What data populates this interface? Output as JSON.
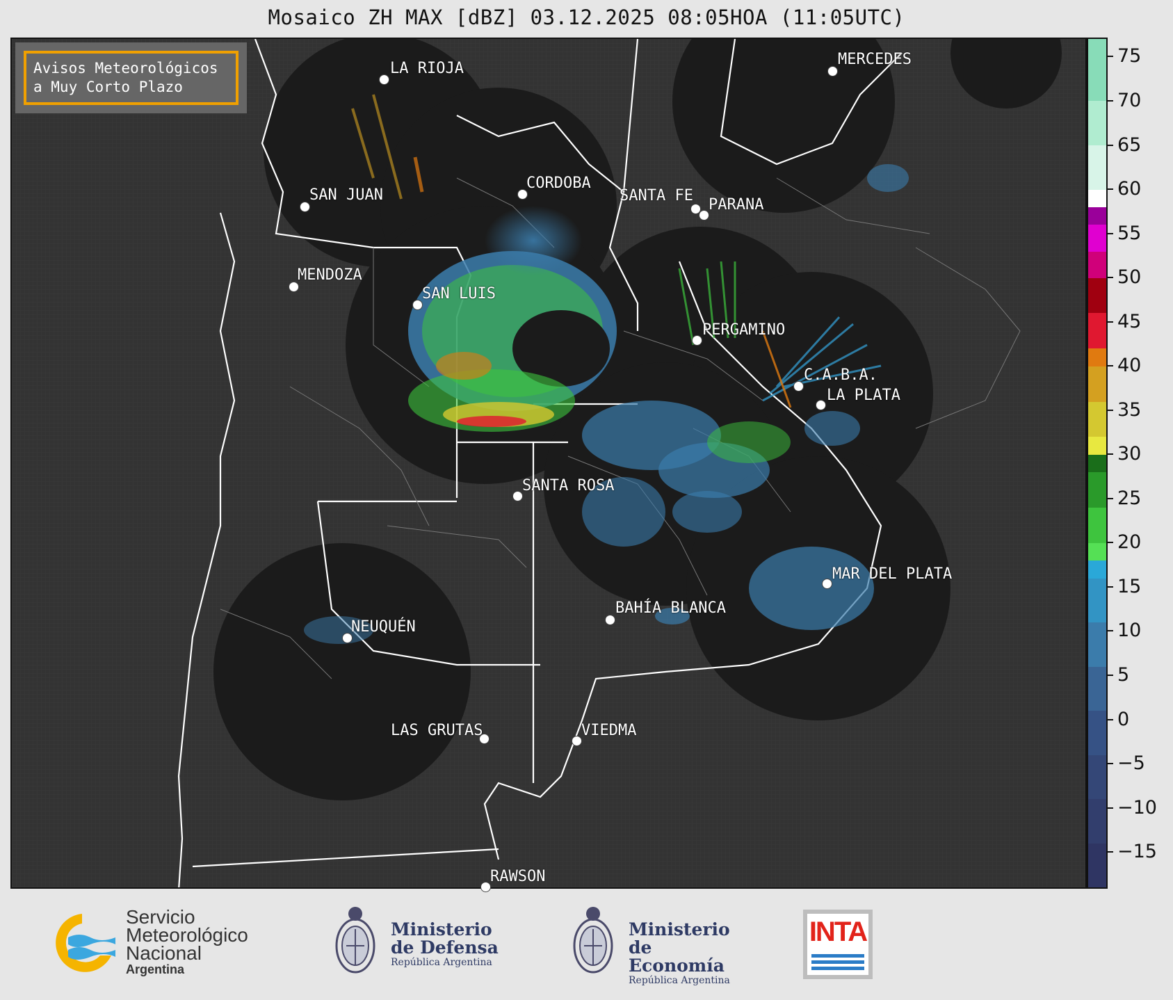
{
  "title": "Mosaico ZH MAX [dBZ] 03.12.2025 08:05HOA (11:05UTC)",
  "notice": {
    "line1": "Avisos Meteorológicos",
    "line2": "a Muy Corto Plazo"
  },
  "colorbar": {
    "unit": "dBZ",
    "range": [
      -19,
      77
    ],
    "ticks": [
      "75",
      "70",
      "65",
      "60",
      "55",
      "50",
      "45",
      "40",
      "35",
      "30",
      "25",
      "20",
      "15",
      "10",
      "5",
      "0",
      "−5",
      "−10",
      "−15"
    ],
    "tick_values": [
      75,
      70,
      65,
      60,
      55,
      50,
      45,
      40,
      35,
      30,
      25,
      20,
      15,
      10,
      5,
      0,
      -5,
      -10,
      -15
    ],
    "bands": [
      {
        "from": -19,
        "to": -14,
        "color": "#2f3563"
      },
      {
        "from": -14,
        "to": -9,
        "color": "#323e6d"
      },
      {
        "from": -9,
        "to": -4,
        "color": "#344777"
      },
      {
        "from": -4,
        "to": 1,
        "color": "#365285"
      },
      {
        "from": 1,
        "to": 6,
        "color": "#3a6595"
      },
      {
        "from": 6,
        "to": 11,
        "color": "#3b7cab"
      },
      {
        "from": 11,
        "to": 16,
        "color": "#3294c4"
      },
      {
        "from": 16,
        "to": 18,
        "color": "#2aa8d8"
      },
      {
        "from": 18,
        "to": 20,
        "color": "#55e055"
      },
      {
        "from": 20,
        "to": 24,
        "color": "#3ec43e"
      },
      {
        "from": 24,
        "to": 28,
        "color": "#2a9a2a"
      },
      {
        "from": 28,
        "to": 30,
        "color": "#1a6e1a"
      },
      {
        "from": 30,
        "to": 32,
        "color": "#e8e840"
      },
      {
        "from": 32,
        "to": 36,
        "color": "#d4c830"
      },
      {
        "from": 36,
        "to": 40,
        "color": "#d4a020"
      },
      {
        "from": 40,
        "to": 42,
        "color": "#e07a10"
      },
      {
        "from": 42,
        "to": 46,
        "color": "#e01830"
      },
      {
        "from": 46,
        "to": 50,
        "color": "#a00010"
      },
      {
        "from": 50,
        "to": 53,
        "color": "#d0007a"
      },
      {
        "from": 53,
        "to": 56,
        "color": "#e000d0"
      },
      {
        "from": 56,
        "to": 58,
        "color": "#9a009a"
      },
      {
        "from": 58,
        "to": 60,
        "color": "#ffffff"
      },
      {
        "from": 60,
        "to": 65,
        "color": "#d8f4e8"
      },
      {
        "from": 65,
        "to": 70,
        "color": "#b0ecd0"
      },
      {
        "from": 70,
        "to": 77,
        "color": "#88dcb8"
      }
    ]
  },
  "cities": [
    {
      "name": "LA RIOJA",
      "dot_id": "la-rioja"
    },
    {
      "name": "MERCEDES",
      "dot_id": "mercedes"
    },
    {
      "name": "SAN JUAN",
      "dot_id": "san-juan"
    },
    {
      "name": "CORDOBA",
      "dot_id": "cordoba"
    },
    {
      "name": "SANTA FE",
      "dot_id": "santa-fe"
    },
    {
      "name": "PARANA",
      "dot_id": "parana"
    },
    {
      "name": "MENDOZA",
      "dot_id": "mendoza"
    },
    {
      "name": "SAN LUIS",
      "dot_id": "san-luis"
    },
    {
      "name": "PERGAMINO",
      "dot_id": "pergamino"
    },
    {
      "name": "C.A.B.A.",
      "dot_id": "caba"
    },
    {
      "name": "LA PLATA",
      "dot_id": "la-plata"
    },
    {
      "name": "SANTA ROSA",
      "dot_id": "santa-rosa"
    },
    {
      "name": "MAR DEL PLATA",
      "dot_id": "mar-del-plata"
    },
    {
      "name": "BAHÍA BLANCA",
      "dot_id": "bahia-blanca"
    },
    {
      "name": "NEUQUÉN",
      "dot_id": "neuquen"
    },
    {
      "name": "LAS GRUTAS",
      "dot_id": "las-grutas"
    },
    {
      "name": "VIEDMA",
      "dot_id": "viedma"
    },
    {
      "name": "RAWSON",
      "dot_id": "rawson"
    }
  ],
  "logos": {
    "smn": {
      "line1": "Servicio",
      "line2": "Meteorológico",
      "line3": "Nacional",
      "sub": "Argentina"
    },
    "defensa": {
      "line1": "Ministerio",
      "line2": "de Defensa",
      "sub": "República Argentina"
    },
    "economia": {
      "line1": "Ministerio",
      "line2": "de Economía",
      "sub": "República Argentina"
    },
    "inta": {
      "text": "INTA"
    }
  }
}
